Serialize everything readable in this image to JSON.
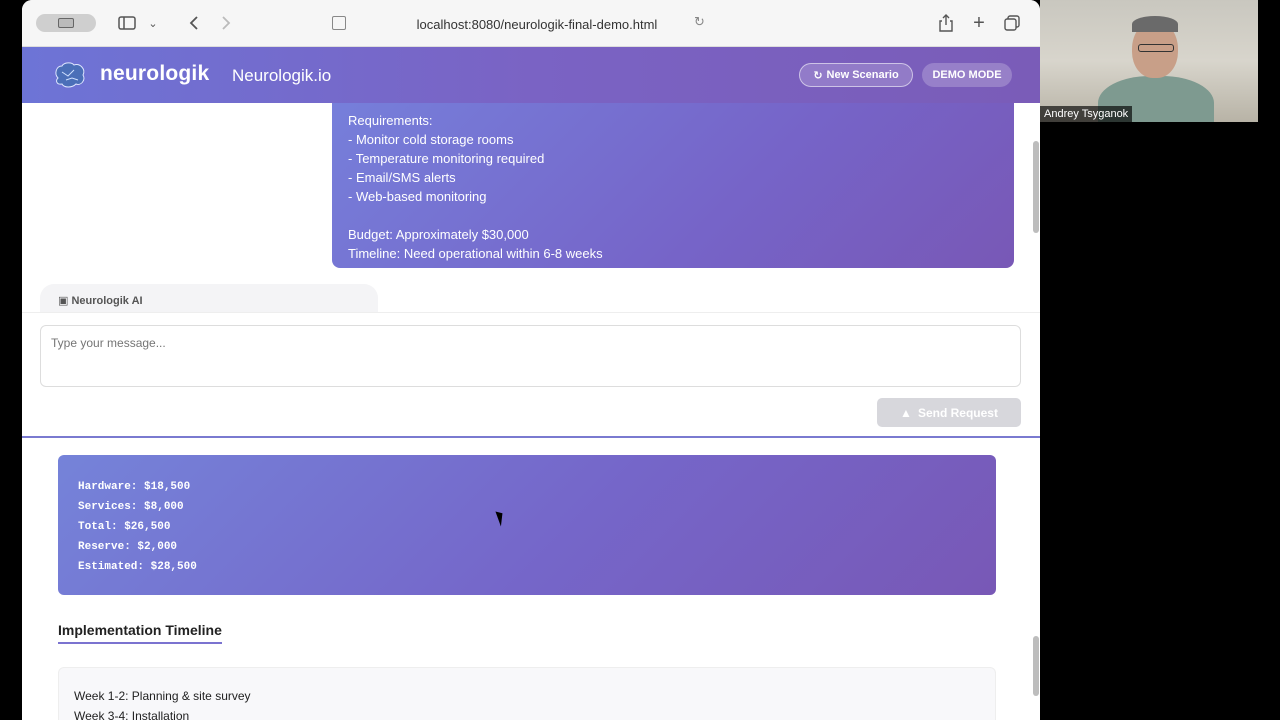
{
  "browser": {
    "url": "localhost:8080/neurologik-final-demo.html"
  },
  "app": {
    "brand": "neurologik",
    "site_name": "Neurologik.io",
    "new_scenario_label": "New Scenario",
    "demo_mode_label": "DEMO MODE"
  },
  "chat": {
    "user_message_lines": [
      "Requirements:",
      "- Monitor cold storage rooms",
      "- Temperature monitoring required",
      "- Email/SMS alerts",
      "- Web-based monitoring",
      "",
      "Budget: Approximately $30,000",
      "Timeline: Need operational within 6-8 weeks"
    ],
    "ai_label": "Neurologik AI"
  },
  "composer": {
    "placeholder": "Type your message...",
    "send_label": "Send Request"
  },
  "result": {
    "budget_lines": [
      "Hardware: $18,500",
      "Services: $8,000",
      "Total: $26,500",
      "Reserve: $2,000",
      "Estimated: $28,500"
    ],
    "timeline_title": "Implementation Timeline",
    "timeline_lines": [
      "Week 1-2: Planning & site survey",
      "Week 3-4: Installation"
    ]
  },
  "video": {
    "participant_name": "Andrey Tsyganok"
  },
  "colors": {
    "accent": "#7668c8",
    "header_start": "#6d74d6",
    "header_end": "#7a5cb8"
  }
}
